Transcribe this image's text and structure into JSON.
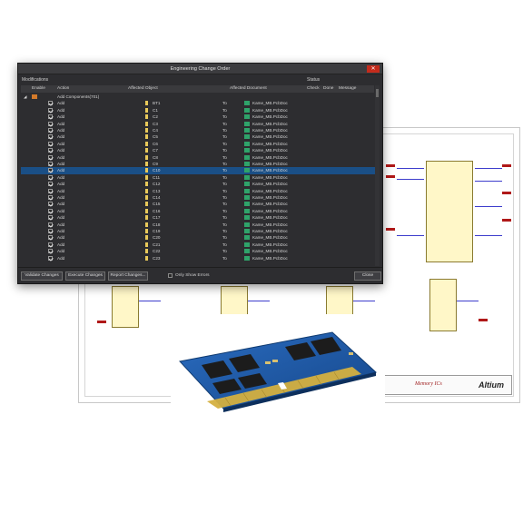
{
  "dialog": {
    "title": "Engineering Change Order",
    "close_label": "✕",
    "section_modifications": "Modifications",
    "section_status": "Status",
    "columns": {
      "enable": "Enable",
      "action": "Action",
      "affected_object": "Affected Object",
      "affected_document": "Affected Document",
      "check": "Check",
      "done": "Done",
      "message": "Message"
    },
    "group": {
      "label": "Add Components(701)"
    },
    "rows": [
      {
        "action": "Add",
        "object": "BT1",
        "to": "To",
        "document": "Kame_MB.PcbDoc"
      },
      {
        "action": "Add",
        "object": "C1",
        "to": "To",
        "document": "Kame_MB.PcbDoc"
      },
      {
        "action": "Add",
        "object": "C2",
        "to": "To",
        "document": "Kame_MB.PcbDoc"
      },
      {
        "action": "Add",
        "object": "C3",
        "to": "To",
        "document": "Kame_MB.PcbDoc"
      },
      {
        "action": "Add",
        "object": "C4",
        "to": "To",
        "document": "Kame_MB.PcbDoc"
      },
      {
        "action": "Add",
        "object": "C5",
        "to": "To",
        "document": "Kame_MB.PcbDoc"
      },
      {
        "action": "Add",
        "object": "C6",
        "to": "To",
        "document": "Kame_MB.PcbDoc"
      },
      {
        "action": "Add",
        "object": "C7",
        "to": "To",
        "document": "Kame_MB.PcbDoc"
      },
      {
        "action": "Add",
        "object": "C8",
        "to": "To",
        "document": "Kame_MB.PcbDoc"
      },
      {
        "action": "Add",
        "object": "C9",
        "to": "To",
        "document": "Kame_MB.PcbDoc"
      },
      {
        "action": "Add",
        "object": "C10",
        "to": "To",
        "document": "Kame_MB.PcbDoc",
        "selected": true
      },
      {
        "action": "Add",
        "object": "C11",
        "to": "To",
        "document": "Kame_MB.PcbDoc"
      },
      {
        "action": "Add",
        "object": "C12",
        "to": "To",
        "document": "Kame_MB.PcbDoc"
      },
      {
        "action": "Add",
        "object": "C13",
        "to": "To",
        "document": "Kame_MB.PcbDoc"
      },
      {
        "action": "Add",
        "object": "C14",
        "to": "To",
        "document": "Kame_MB.PcbDoc"
      },
      {
        "action": "Add",
        "object": "C15",
        "to": "To",
        "document": "Kame_MB.PcbDoc"
      },
      {
        "action": "Add",
        "object": "C16",
        "to": "To",
        "document": "Kame_MB.PcbDoc"
      },
      {
        "action": "Add",
        "object": "C17",
        "to": "To",
        "document": "Kame_MB.PcbDoc"
      },
      {
        "action": "Add",
        "object": "C18",
        "to": "To",
        "document": "Kame_MB.PcbDoc"
      },
      {
        "action": "Add",
        "object": "C19",
        "to": "To",
        "document": "Kame_MB.PcbDoc"
      },
      {
        "action": "Add",
        "object": "C20",
        "to": "To",
        "document": "Kame_MB.PcbDoc"
      },
      {
        "action": "Add",
        "object": "C21",
        "to": "To",
        "document": "Kame_MB.PcbDoc"
      },
      {
        "action": "Add",
        "object": "C22",
        "to": "To",
        "document": "Kame_MB.PcbDoc"
      },
      {
        "action": "Add",
        "object": "C23",
        "to": "To",
        "document": "Kame_MB.PcbDoc"
      }
    ],
    "buttons": {
      "validate": "Validate Changes",
      "execute": "Execute Changes",
      "report": "Report Changes...",
      "close": "Close"
    },
    "only_show_errors": "Only Show Errors"
  },
  "schematic": {
    "title_text": "Memory ICs",
    "logo": "Altium"
  },
  "icons": {
    "enable_checkbox": "checkbox-checked-icon",
    "component": "component-icon",
    "pcb_document": "pcb-document-icon",
    "group_folder": "folder-icon",
    "expand": "triangle-expand-icon"
  },
  "colors": {
    "dialog_bg": "#2d2d30",
    "selection": "#1a4f86",
    "close_red": "#c42b1c",
    "pcb_blue": "#1f5aa6",
    "gold_contacts": "#d4b040"
  }
}
